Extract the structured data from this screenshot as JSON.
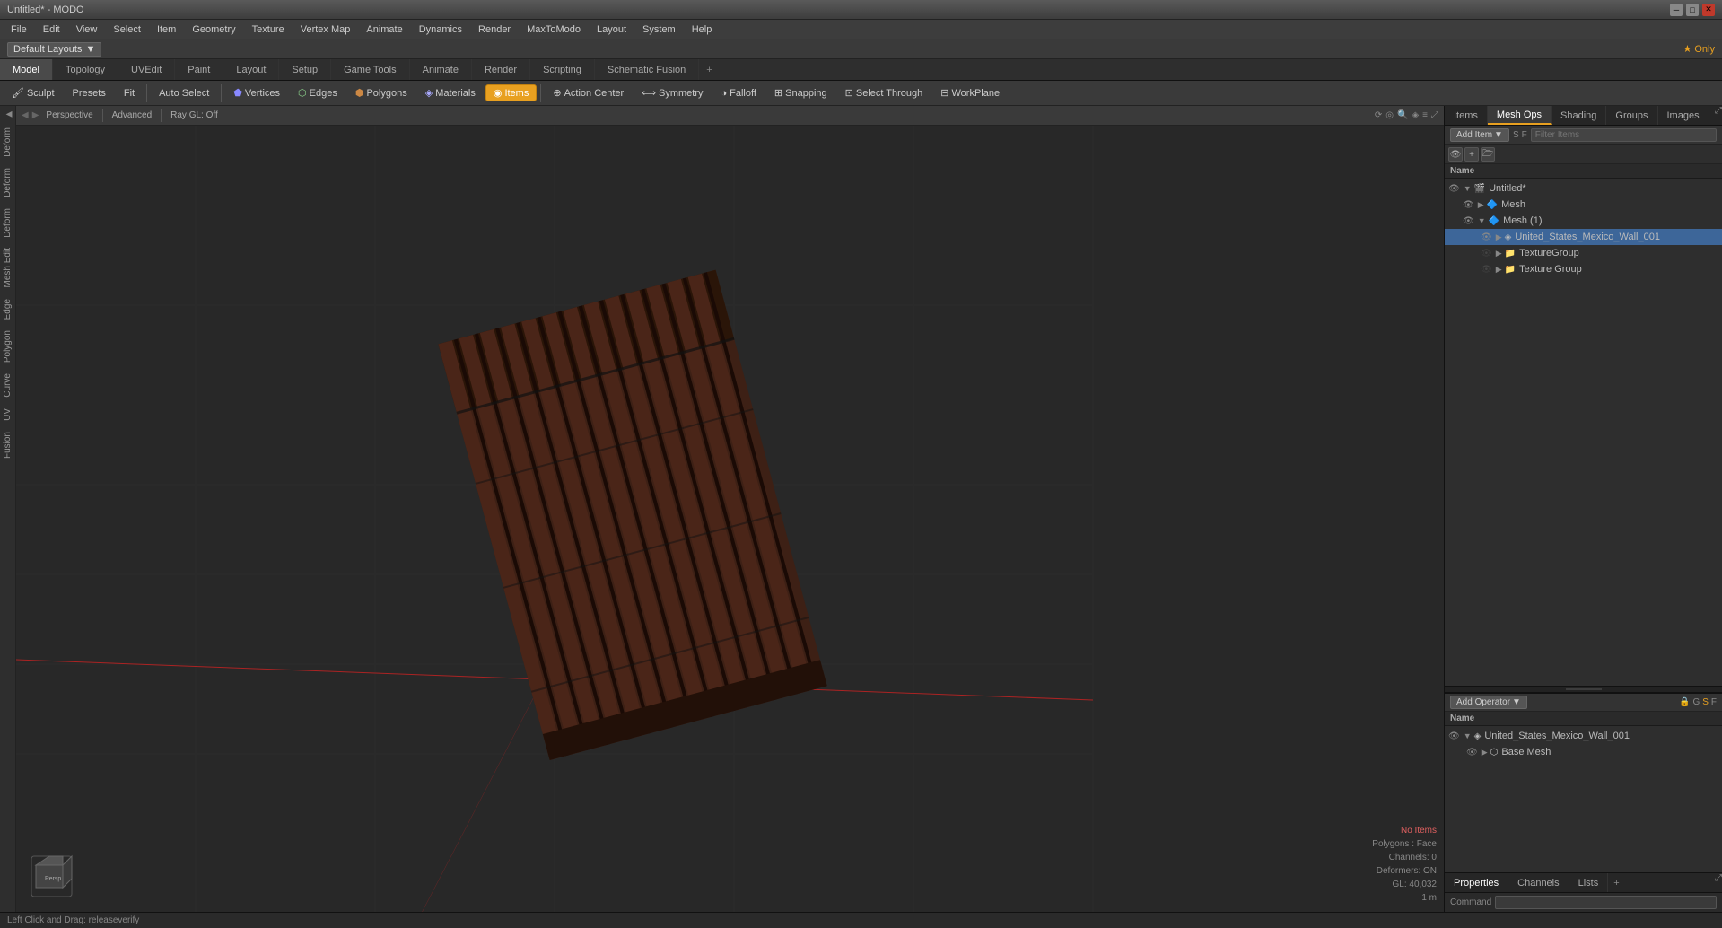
{
  "app": {
    "title": "Untitled* - MODO"
  },
  "titlebar": {
    "title": "Untitled* - MODO"
  },
  "menubar": {
    "items": [
      "File",
      "Edit",
      "View",
      "Select",
      "Item",
      "Geometry",
      "Texture",
      "Vertex Map",
      "Animate",
      "Dynamics",
      "Render",
      "MaxToModo",
      "Layout",
      "System",
      "Help"
    ]
  },
  "layoutbar": {
    "layout_label": "Default Layouts",
    "star_label": "★ Only"
  },
  "toptabs": {
    "tabs": [
      "Model",
      "Topology",
      "UVEdit",
      "Paint",
      "Layout",
      "Setup",
      "Game Tools",
      "Animate",
      "Render",
      "Scripting",
      "Schematic Fusion"
    ],
    "active": "Model",
    "add_label": "+"
  },
  "toolbar": {
    "sculpt_label": "Sculpt",
    "presets_label": "Presets",
    "fit_label": "Fit",
    "auto_select_label": "Auto Select",
    "vertices_label": "Vertices",
    "edges_label": "Edges",
    "polygons_label": "Polygons",
    "materials_label": "Materials",
    "items_label": "Items",
    "action_center_label": "Action Center",
    "symmetry_label": "Symmetry",
    "falloff_label": "Falloff",
    "snapping_label": "Snapping",
    "select_through_label": "Select Through",
    "workplane_label": "WorkPlane"
  },
  "viewport": {
    "view_mode": "Perspective",
    "advanced_label": "Advanced",
    "raygl_label": "Ray GL: Off",
    "no_items": "No Items",
    "polygons": "Polygons : Face",
    "channels": "Channels: 0",
    "deformers": "Deformers: ON",
    "gl": "GL: 40,032",
    "unit": "1 m"
  },
  "sidebar_tabs": {
    "items": [
      "",
      "Deform",
      "Deform",
      "Deform",
      "Mesh Edit",
      "Edge",
      "Polygon",
      "Curve",
      "UV",
      "Fusion"
    ]
  },
  "right_panel": {
    "top_tabs": [
      "Items",
      "Mesh Ops",
      "Shading",
      "Groups",
      "Images"
    ],
    "active_tab": "Mesh Ops",
    "add_item_label": "Add Item",
    "filter_placeholder": "Filter Items",
    "name_col": "Name",
    "tree": [
      {
        "id": "untitled",
        "label": "Untitled*",
        "indent": 0,
        "expanded": true,
        "type": "scene",
        "visible": true
      },
      {
        "id": "mesh-parent",
        "label": "Mesh",
        "indent": 1,
        "expanded": false,
        "type": "mesh",
        "visible": true
      },
      {
        "id": "mesh-child",
        "label": "Mesh (1)",
        "indent": 1,
        "expanded": true,
        "type": "mesh",
        "visible": true
      },
      {
        "id": "us-mexico-wall",
        "label": "United_States_Mexico_Wall_001",
        "indent": 2,
        "expanded": false,
        "type": "mesh-item",
        "visible": true
      },
      {
        "id": "texture-group",
        "label": "TextureGroup",
        "indent": 2,
        "expanded": false,
        "type": "group",
        "visible": false
      },
      {
        "id": "texture-group-2",
        "label": "Texture Group",
        "indent": 2,
        "expanded": false,
        "type": "group",
        "visible": false
      }
    ]
  },
  "operator_panel": {
    "add_operator_label": "Add Operator",
    "name_col": "Name",
    "tree": [
      {
        "id": "us-mexico-wall-op",
        "label": "United_States_Mexico_Wall_001",
        "indent": 0,
        "expanded": true,
        "visible": true
      },
      {
        "id": "base-mesh",
        "label": "Base Mesh",
        "indent": 1,
        "expanded": false,
        "visible": true
      }
    ]
  },
  "bottom_panel": {
    "tabs": [
      "Properties",
      "Channels",
      "Lists"
    ],
    "active_tab": "Properties",
    "add_label": "+"
  },
  "statusbar": {
    "message": "Left Click and Drag:  releaseverify"
  },
  "command_bar": {
    "label": "Command",
    "placeholder": ""
  }
}
